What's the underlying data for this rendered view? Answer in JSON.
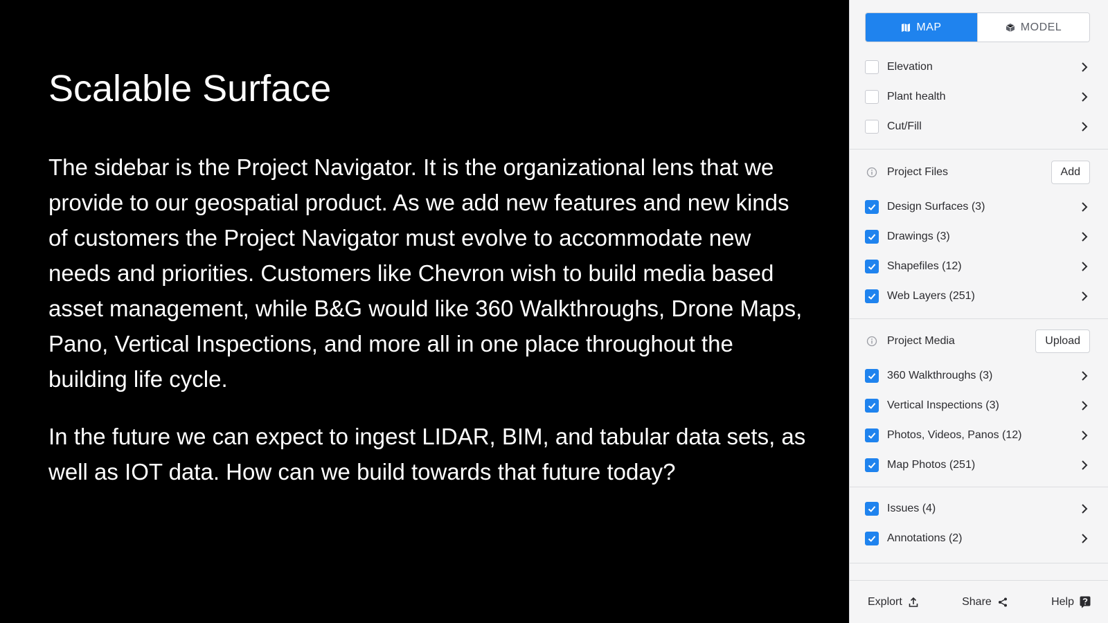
{
  "slide": {
    "title": "Scalable Surface",
    "paragraphs": [
      "The sidebar is the Project Navigator. It is the organizational lens that we provide to our geospatial product. As we add new features and new kinds of customers the Project Navigator must evolve to accommodate new needs and priorities. Customers like Chevron wish to build media based asset management, while B&G would like 360 Walkthroughs, Drone Maps, Pano, Vertical Inspections, and more all in one place throughout the building life cycle.",
      "In the future we can expect to ingest LIDAR, BIM, and tabular data sets, as well as IOT data. How can we build towards that future today?"
    ]
  },
  "panel": {
    "view_toggle": {
      "map_label": "MAP",
      "model_label": "MODEL",
      "active": "MAP"
    },
    "layers": [
      {
        "label": "Elevation",
        "checked": false
      },
      {
        "label": "Plant health",
        "checked": false
      },
      {
        "label": "Cut/Fill",
        "checked": false
      }
    ],
    "project_files": {
      "title": "Project Files",
      "button": "Add",
      "items": [
        {
          "label": "Design Surfaces (3)",
          "checked": true
        },
        {
          "label": "Drawings (3)",
          "checked": true
        },
        {
          "label": "Shapefiles (12)",
          "checked": true
        },
        {
          "label": "Web Layers (251)",
          "checked": true
        }
      ]
    },
    "project_media": {
      "title": "Project Media",
      "button": "Upload",
      "items": [
        {
          "label": "360 Walkthroughs (3)",
          "checked": true
        },
        {
          "label": "Vertical Inspections (3)",
          "checked": true
        },
        {
          "label": "Photos, Videos, Panos (12)",
          "checked": true
        },
        {
          "label": "Map Photos (251)",
          "checked": true
        }
      ]
    },
    "extras": [
      {
        "label": "Issues (4)",
        "checked": true
      },
      {
        "label": "Annotations (2)",
        "checked": true
      }
    ],
    "footer": {
      "export": "Explort",
      "share": "Share",
      "help": "Help"
    },
    "colors": {
      "accent": "#1f83ee",
      "panel_bg": "#f5f5f6",
      "slide_bg": "#000000"
    },
    "icons": {
      "map": "map-icon",
      "model": "cube-icon",
      "chevron": "chevron-right-icon",
      "check": "check-icon",
      "info": "info-icon",
      "export": "upload-icon",
      "share": "share-icon",
      "help": "help-icon"
    }
  }
}
